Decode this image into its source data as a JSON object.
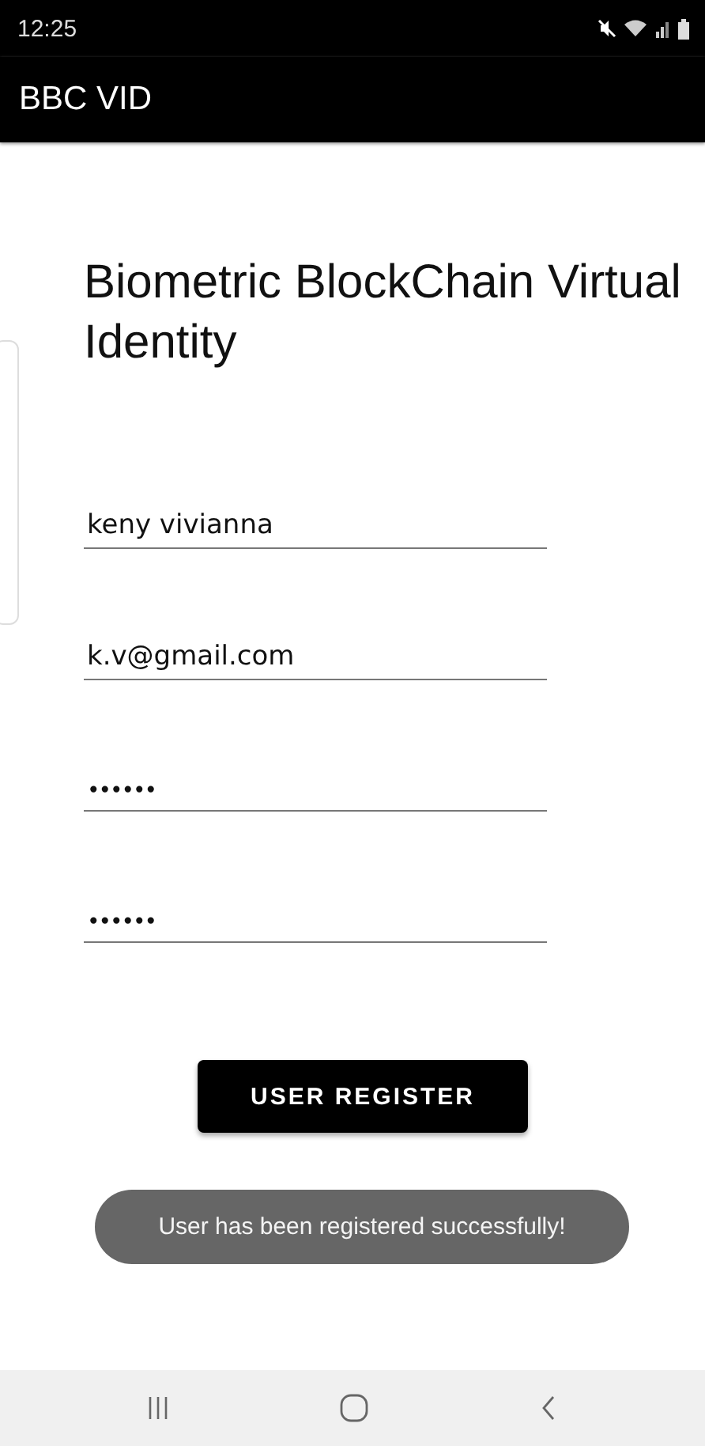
{
  "status_bar": {
    "time": "12:25"
  },
  "app_bar": {
    "title": "BBC VID"
  },
  "heading": "Biometric BlockChain Virtual Identity",
  "fields": [
    {
      "kind": "text",
      "value": "keny vivianna"
    },
    {
      "kind": "text",
      "value": "k.v@gmail.com"
    },
    {
      "kind": "password",
      "value": "••••••"
    },
    {
      "kind": "password",
      "value": "••••••"
    }
  ],
  "register_button": "USER REGISTER",
  "toast": "User has been registered successfully!"
}
